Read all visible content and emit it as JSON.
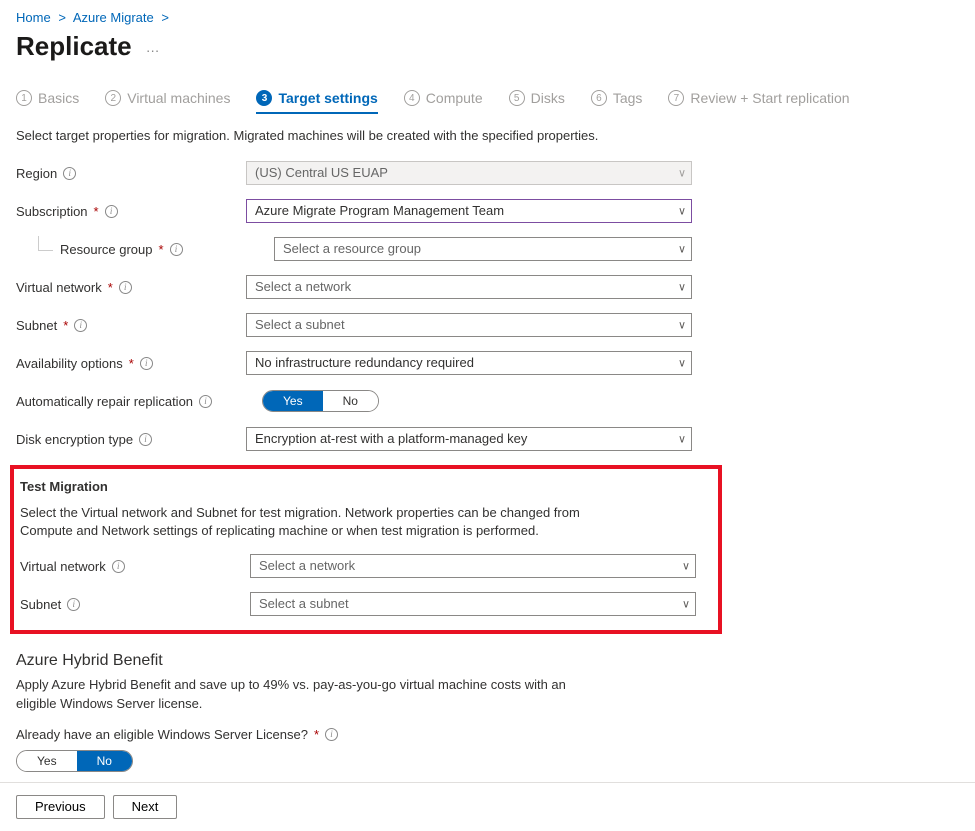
{
  "breadcrumbs": {
    "home": "Home",
    "service": "Azure Migrate",
    "sep": ">"
  },
  "page": {
    "title": "Replicate",
    "ellipsis": "…"
  },
  "tabs": [
    {
      "num": "1",
      "label": "Basics"
    },
    {
      "num": "2",
      "label": "Virtual machines"
    },
    {
      "num": "3",
      "label": "Target settings"
    },
    {
      "num": "4",
      "label": "Compute"
    },
    {
      "num": "5",
      "label": "Disks"
    },
    {
      "num": "6",
      "label": "Tags"
    },
    {
      "num": "7",
      "label": "Review + Start replication"
    }
  ],
  "instruction": "Select target properties for migration. Migrated machines will be created with the specified properties.",
  "form": {
    "region": {
      "label": "Region",
      "value": "(US) Central US EUAP"
    },
    "subscription": {
      "label": "Subscription",
      "value": "Azure Migrate Program Management Team"
    },
    "resource_group": {
      "label": "Resource group",
      "value": "Select a resource group"
    },
    "vnet": {
      "label": "Virtual network",
      "value": "Select a network"
    },
    "subnet": {
      "label": "Subnet",
      "value": "Select a subnet"
    },
    "availability": {
      "label": "Availability options",
      "value": "No infrastructure redundancy required"
    },
    "auto_repair": {
      "label": "Automatically repair replication",
      "yes": "Yes",
      "no": "No"
    },
    "disk_enc": {
      "label": "Disk encryption type",
      "value": "Encryption at-rest with a platform-managed key"
    }
  },
  "test_migration": {
    "heading": "Test Migration",
    "desc": "Select the Virtual network and Subnet for test migration. Network properties can be changed from Compute and Network settings of replicating machine or when test migration is performed.",
    "vnet": {
      "label": "Virtual network",
      "value": "Select a network"
    },
    "subnet": {
      "label": "Subnet",
      "value": "Select a subnet"
    }
  },
  "hybrid": {
    "heading": "Azure Hybrid Benefit",
    "desc": "Apply Azure Hybrid Benefit and save up to 49% vs. pay-as-you-go virtual machine costs with an eligible Windows Server license.",
    "question": "Already have an eligible Windows Server License?",
    "yes": "Yes",
    "no": "No"
  },
  "footer": {
    "previous": "Previous",
    "next": "Next"
  },
  "glyph": {
    "chevron": "∨"
  }
}
